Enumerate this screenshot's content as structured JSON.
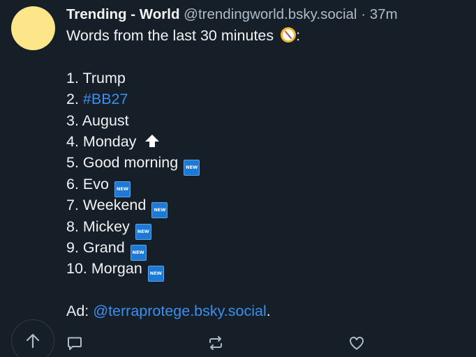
{
  "post": {
    "display_name": "Trending - World",
    "handle": "@trendingworld.bsky.social",
    "separator": "·",
    "time": "37m",
    "intro": "Words from the last 30 minutes",
    "intro_suffix": ":",
    "trends": [
      {
        "prefix": "1. ",
        "word": "Trump"
      },
      {
        "prefix": "2. ",
        "word": "#BB27"
      },
      {
        "prefix": "3. ",
        "word": "August"
      },
      {
        "prefix": "4. ",
        "word": "Monday"
      },
      {
        "prefix": "5. ",
        "word": "Good morning"
      },
      {
        "prefix": "6. ",
        "word": "Evo"
      },
      {
        "prefix": "7. ",
        "word": "Weekend"
      },
      {
        "prefix": "8. ",
        "word": "Mickey"
      },
      {
        "prefix": "9. ",
        "word": "Grand"
      },
      {
        "prefix": "10. ",
        "word": "Morgan"
      }
    ],
    "new_badge_label": "NEW",
    "ad_label": "Ad: ",
    "ad_link": "@terraprotege.bsky.social",
    "ad_suffix": "."
  },
  "icons": {
    "intro_emoji": "compass-icon",
    "trend_4_marker": "up-arrow-icon",
    "new_marker": "new-badge",
    "scroll_top": "arrow-up-icon",
    "reply": "reply-icon",
    "repost": "repost-icon",
    "like": "heart-icon"
  },
  "colors": {
    "background": "#161e27",
    "text": "#f1f3f5",
    "muted": "#aebbc9",
    "link": "#3b8ff0",
    "avatar": "#fde68a",
    "badge": "#1c7ad6"
  }
}
